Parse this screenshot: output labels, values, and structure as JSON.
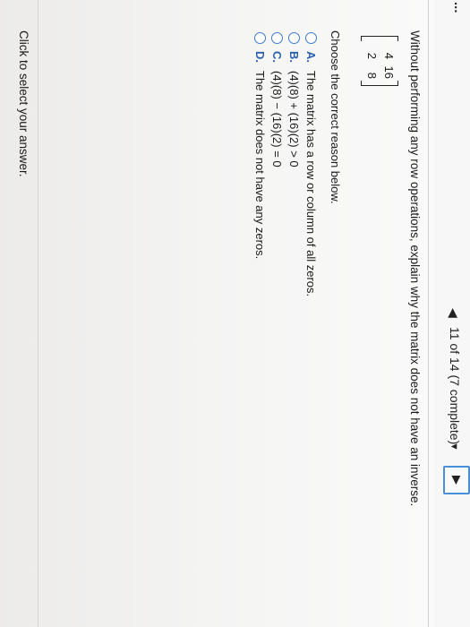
{
  "header": {
    "title_fragment": "...",
    "progress": "11 of 14 (7 complete)",
    "prev_icon": "left-arrow-icon",
    "dropdown_icon": "chevron-down-icon",
    "next_icon": "right-arrow-icon"
  },
  "question": {
    "text": "Without performing any row operations, explain why the matrix does not have an inverse.",
    "matrix": [
      [
        "4",
        "16"
      ],
      [
        "2",
        "8"
      ]
    ]
  },
  "instruction": "Choose the correct reason below.",
  "choices": [
    {
      "letter": "A.",
      "text": "The matrix has a row or column of all zeros."
    },
    {
      "letter": "B.",
      "text": "(4)(8) + (16)(2) > 0"
    },
    {
      "letter": "C.",
      "text": "(4)(8) − (16)(2) = 0"
    },
    {
      "letter": "D.",
      "text": "The matrix does not have any zeros."
    }
  ],
  "footer": {
    "text": "Click to select your answer."
  },
  "colors": {
    "accent": "#3b7bd0",
    "next_button_border": "#4a90d9"
  }
}
